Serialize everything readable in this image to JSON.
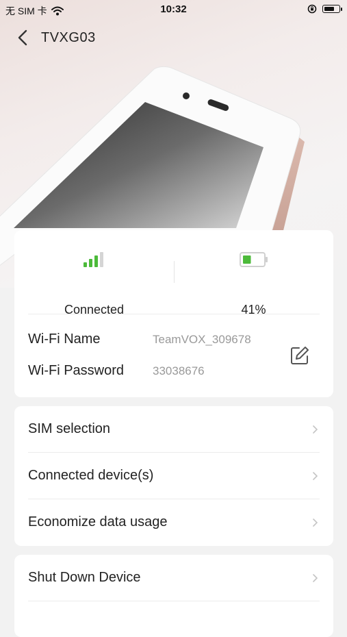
{
  "status_bar": {
    "carrier": "无 SIM 卡",
    "time": "10:32"
  },
  "nav": {
    "title": "TVXG03"
  },
  "status": {
    "connection_label": "Connected",
    "signal_bars_active": 3,
    "signal_bars_total": 4,
    "battery_label": "41%",
    "battery_level": 0.41
  },
  "wifi": {
    "name_label": "Wi-Fi Name",
    "name_value": "TeamVOX_309678",
    "password_label": "Wi-Fi Password",
    "password_value": "33038676"
  },
  "menu": {
    "items": [
      {
        "label": "SIM selection"
      },
      {
        "label": "Connected device(s)"
      },
      {
        "label": "Economize data usage"
      }
    ]
  },
  "menu2": {
    "items": [
      {
        "label": "Shut Down Device"
      }
    ]
  },
  "colors": {
    "accent_green": "#4cba3a",
    "muted_text": "#999999",
    "background": "#f2f2f2"
  },
  "icons": [
    "wifi-icon",
    "orientation-lock-icon",
    "battery-icon",
    "back-chevron-icon",
    "signal-icon",
    "edit-icon",
    "chevron-right-icon"
  ]
}
